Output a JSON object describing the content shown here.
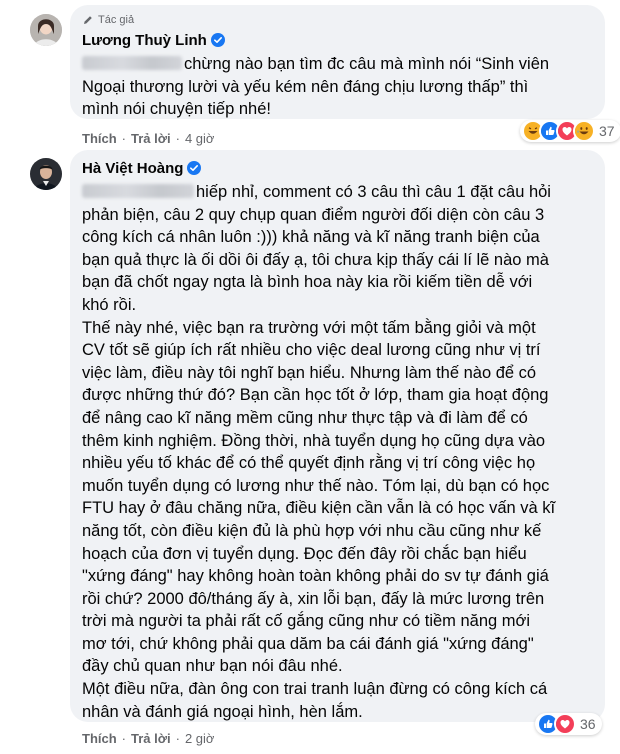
{
  "comments": [
    {
      "badge": "Tác giả",
      "author": "Lương Thuỳ Linh",
      "lines": [
        "chừng nào bạn tìm đc câu mà mình nói “Sinh viên",
        "Ngoại thương lười và yếu kém nên đáng chịu lương thấp” thì",
        "mình nói chuyện tiếp nhé!"
      ],
      "like_label": "Thích",
      "reply_label": "Trả lời",
      "time": "4 giờ",
      "reaction_count": "37",
      "reactions": [
        "haha",
        "like",
        "love",
        "laugh-tears"
      ]
    },
    {
      "author": "Hà Việt Hoàng",
      "lines": [
        "hiếp nhỉ, comment có 3 câu thì câu 1 đặt câu hỏi",
        "phản biện, câu 2 quy chụp quan điểm người đối diện còn câu 3",
        "công kích cá nhân luôn :))) khả năng và kĩ năng tranh biện của",
        "bạn quả thực là ối dồi ôi đấy ạ, tôi chưa kịp thấy cái lí lẽ nào mà",
        "bạn đã chốt ngay ngta là bình hoa này kia rồi kiếm tiền dễ với",
        "khó rồi.",
        "Thế này nhé, việc bạn ra trường với một tấm bằng giỏi và một",
        "CV tốt sẽ giúp ích rất nhiều cho việc deal lương cũng như vị trí",
        "việc làm, điều này tôi nghĩ bạn hiểu. Nhưng làm thế nào để có",
        "được những thứ đó? Bạn cần học tốt ở lớp, tham gia hoạt động",
        "để nâng cao kĩ năng mềm cũng như thực tập và đi làm để có",
        "thêm kinh nghiệm. Đồng thời, nhà tuyển dụng họ cũng dựa vào",
        "nhiều yếu tố khác để có thể quyết định rằng vị trí công việc họ",
        "muốn tuyển dụng có lương như thế nào. Tóm lại, dù bạn có học",
        "FTU hay ở đâu chăng nữa, điều kiện cần vẫn là có học vấn và kĩ",
        "năng tốt, còn điều kiện đủ là phù hợp với nhu cầu cũng như kế",
        "hoạch của đơn vị tuyển dụng. Đọc đến đây rồi chắc bạn hiểu",
        "\"xứng đáng\" hay không hoàn toàn không phải do sv tự đánh giá",
        "rồi chứ? 2000 đô/tháng ấy à, xin lỗi bạn, đấy là mức lương trên",
        "trời mà người ta phải rất cố gắng cũng như có tiềm năng mới",
        "mơ tới, chứ không phải qua dăm ba cái đánh giá \"xứng đáng\"",
        "đầy chủ quan như bạn nói đâu nhé.",
        "Một điều nữa, đàn ông con trai tranh luận đừng có công kích cá",
        "nhân và đánh giá ngoại hình, hèn lắm."
      ],
      "like_label": "Thích",
      "reply_label": "Trả lời",
      "time": "2 giờ",
      "reaction_count": "36",
      "reactions": [
        "like",
        "love"
      ]
    }
  ],
  "colors": {
    "bubble": "#f0f2f5",
    "link": "#050505",
    "meta": "#65676b",
    "verified": "#1877f2",
    "like": "#1877f2",
    "love": "#f33e58",
    "haha": "#f7b125"
  },
  "icons": {
    "badge": "pen-icon",
    "verified": "verified-badge-icon"
  }
}
